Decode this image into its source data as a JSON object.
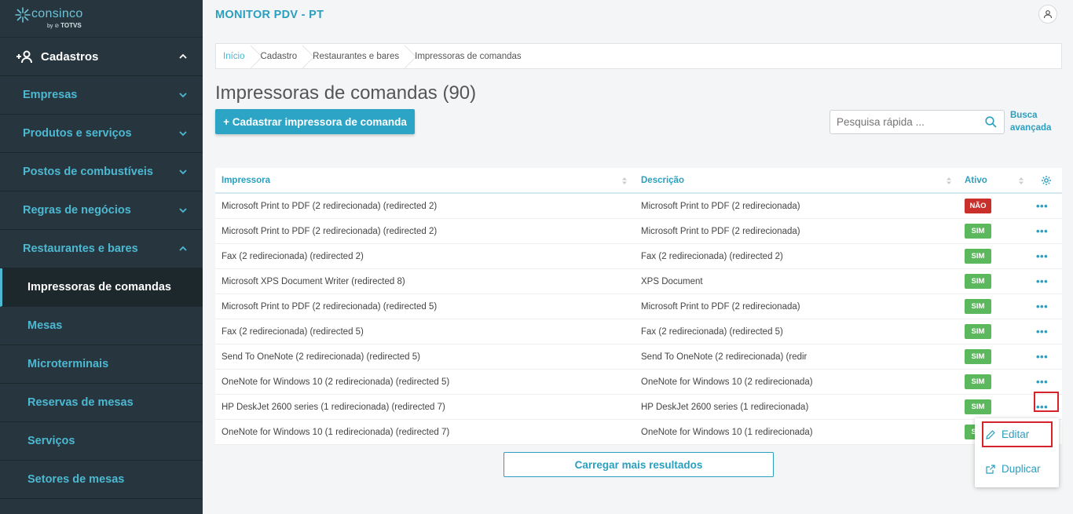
{
  "brand": {
    "name": "consinco",
    "by": "by",
    "parent": "TOTVS"
  },
  "sidebar": {
    "top": {
      "label": "Cadastros"
    },
    "groups": [
      {
        "label": "Empresas"
      },
      {
        "label": "Produtos e serviços"
      },
      {
        "label": "Postos de combustíveis"
      },
      {
        "label": "Regras de negócios"
      },
      {
        "label": "Restaurantes e bares"
      }
    ],
    "subitems": [
      {
        "label": "Impressoras de comandas",
        "active": true
      },
      {
        "label": "Mesas"
      },
      {
        "label": "Microterminais"
      },
      {
        "label": "Reservas de mesas"
      },
      {
        "label": "Serviços"
      },
      {
        "label": "Setores de mesas"
      }
    ]
  },
  "header": {
    "app_title": "MONITOR PDV - PT"
  },
  "breadcrumb": [
    "Início",
    "Cadastro",
    "Restaurantes e bares",
    "Impressoras de comandas"
  ],
  "page": {
    "title": "Impressoras de comandas (90)",
    "add_button": "+ Cadastrar impressora de comanda",
    "search_placeholder": "Pesquisa rápida ...",
    "advanced_search": "Busca avançada",
    "load_more": "Carregar mais resultados"
  },
  "table": {
    "columns": [
      "Impressora",
      "Descrição",
      "Ativo"
    ],
    "rows": [
      {
        "printer": "Microsoft Print to PDF (2 redirecionada) (redirected 2)",
        "description": "Microsoft Print to PDF (2 redirecionada)",
        "active": "NÃO"
      },
      {
        "printer": "Microsoft Print to PDF (2 redirecionada) (redirected 2)",
        "description": "Microsoft Print to PDF (2 redirecionada)",
        "active": "SIM"
      },
      {
        "printer": "Fax (2 redirecionada) (redirected 2)",
        "description": "Fax (2 redirecionada) (redirected 2)",
        "active": "SIM"
      },
      {
        "printer": "Microsoft XPS Document Writer (redirected 8)",
        "description": "XPS Document",
        "active": "SIM"
      },
      {
        "printer": "Microsoft Print to PDF (2 redirecionada) (redirected 5)",
        "description": "Microsoft Print to PDF (2 redirecionada)",
        "active": "SIM"
      },
      {
        "printer": "Fax (2 redirecionada) (redirected 5)",
        "description": "Fax (2 redirecionada) (redirected 5)",
        "active": "SIM"
      },
      {
        "printer": "Send To OneNote (2 redirecionada) (redirected 5)",
        "description": "Send To OneNote (2 redirecionada) (redir",
        "active": "SIM"
      },
      {
        "printer": "OneNote for Windows 10 (2 redirecionada) (redirected 5)",
        "description": "OneNote for Windows 10 (2 redirecionada)",
        "active": "SIM"
      },
      {
        "printer": "HP DeskJet 2600 series (1 redirecionada) (redirected 7)",
        "description": "HP DeskJet 2600 series (1 redirecionada)",
        "active": "SIM"
      },
      {
        "printer": "OneNote for Windows 10 (1 redirecionada) (redirected 7)",
        "description": "OneNote for Windows 10 (1 redirecionada)",
        "active": "SIM"
      }
    ]
  },
  "row_menu": {
    "edit": "Editar",
    "duplicate": "Duplicar"
  },
  "row_actions_label": "•••",
  "colors": {
    "accent": "#2ba4c5",
    "sidebar": "#27363e",
    "active_yes": "#5cb85c",
    "active_no": "#c9302c",
    "highlight": "#d6222a"
  }
}
